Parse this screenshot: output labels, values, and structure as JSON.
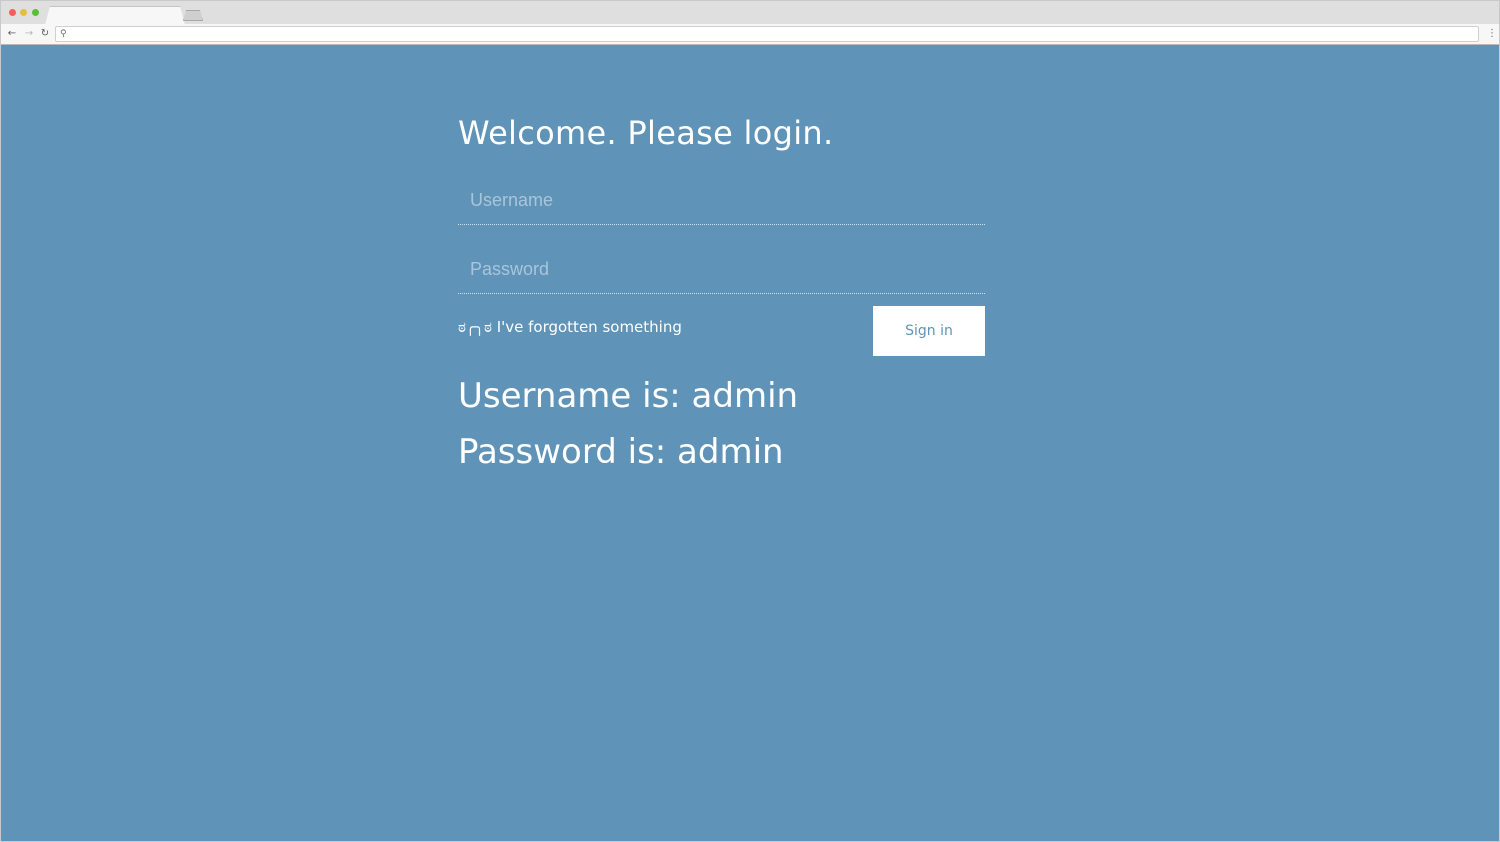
{
  "browser": {
    "colors": {
      "close": "#fc5b57",
      "minimize": "#e5bf3c",
      "maximize": "#57c038"
    },
    "icons": {
      "back": "arrow-left-icon",
      "forward": "arrow-right-icon",
      "reload": "reload-icon",
      "search": "search-icon",
      "menu": "more-vertical-icon"
    },
    "nav_glyphs": {
      "back": "←",
      "forward": "→",
      "reload": "↻",
      "search": "⚲",
      "menu": "⋮"
    },
    "address": ""
  },
  "page": {
    "background": "#5f93b8",
    "title": "Welcome. Please login.",
    "username": {
      "placeholder": "Username",
      "value": ""
    },
    "password": {
      "placeholder": "Password",
      "value": ""
    },
    "forgot_link": "ಠ╭╮ಠ I've forgotten something",
    "signin_button": "Sign in",
    "hints": {
      "username": "Username is: admin",
      "password": "Password is: admin"
    }
  }
}
